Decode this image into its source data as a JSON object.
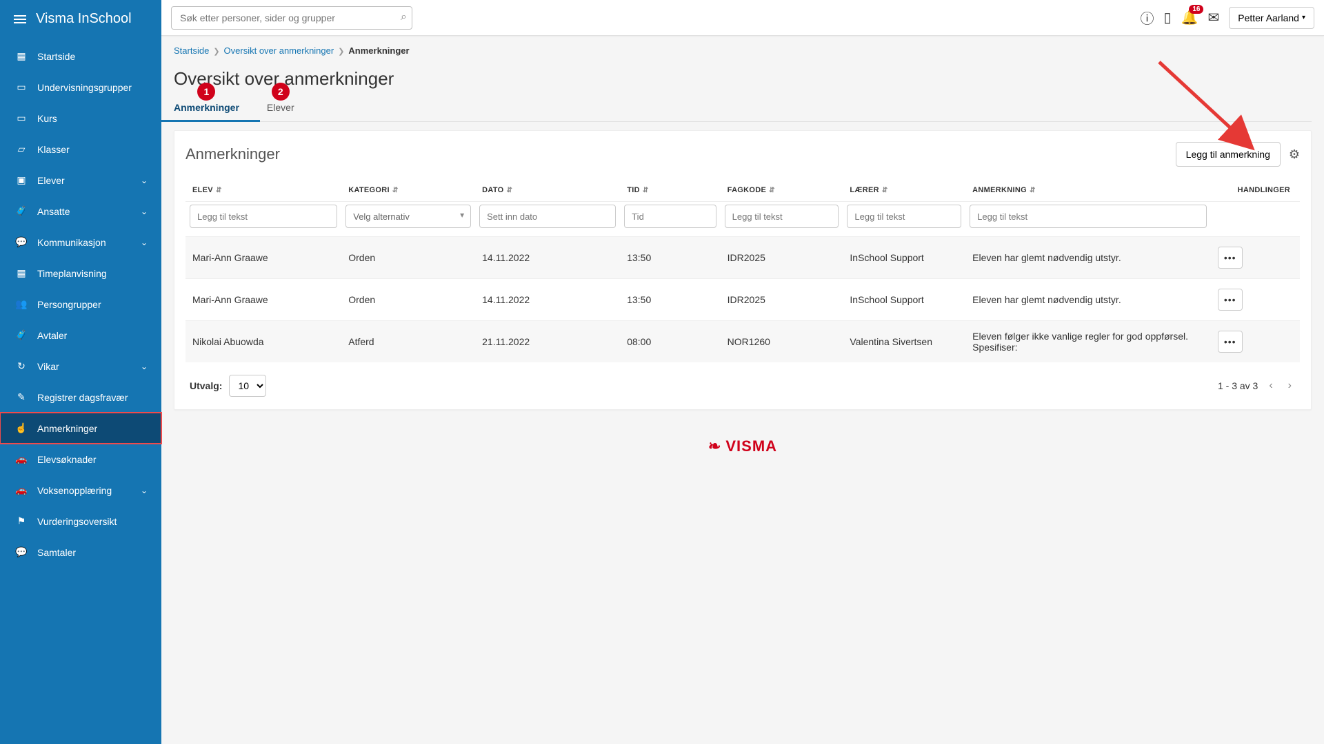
{
  "app_name": "Visma InSchool",
  "search_placeholder": "Søk etter personer, sider og grupper",
  "notifications_count": "16",
  "user_name": "Petter Aarland",
  "sidebar": {
    "items": [
      {
        "label": "Startside",
        "icon": "▦",
        "expandable": false,
        "active": false
      },
      {
        "label": "Undervisningsgrupper",
        "icon": "▭",
        "expandable": false,
        "active": false
      },
      {
        "label": "Kurs",
        "icon": "▭",
        "expandable": false,
        "active": false
      },
      {
        "label": "Klasser",
        "icon": "▱",
        "expandable": false,
        "active": false
      },
      {
        "label": "Elever",
        "icon": "▣",
        "expandable": true,
        "active": false
      },
      {
        "label": "Ansatte",
        "icon": "🧳",
        "expandable": true,
        "active": false
      },
      {
        "label": "Kommunikasjon",
        "icon": "💬",
        "expandable": true,
        "active": false
      },
      {
        "label": "Timeplanvisning",
        "icon": "▦",
        "expandable": false,
        "active": false
      },
      {
        "label": "Persongrupper",
        "icon": "👥",
        "expandable": false,
        "active": false
      },
      {
        "label": "Avtaler",
        "icon": "🧳",
        "expandable": false,
        "active": false
      },
      {
        "label": "Vikar",
        "icon": "↻",
        "expandable": true,
        "active": false
      },
      {
        "label": "Registrer dagsfravær",
        "icon": "✎",
        "expandable": false,
        "active": false
      },
      {
        "label": "Anmerkninger",
        "icon": "☝",
        "expandable": false,
        "active": true
      },
      {
        "label": "Elevsøknader",
        "icon": "🚗",
        "expandable": false,
        "active": false
      },
      {
        "label": "Voksenopplæring",
        "icon": "🚗",
        "expandable": true,
        "active": false
      },
      {
        "label": "Vurderingsoversikt",
        "icon": "⚑",
        "expandable": false,
        "active": false
      },
      {
        "label": "Samtaler",
        "icon": "💬",
        "expandable": false,
        "active": false
      }
    ]
  },
  "breadcrumb": [
    {
      "label": "Startside",
      "link": true
    },
    {
      "label": "Oversikt over anmerkninger",
      "link": true
    },
    {
      "label": "Anmerkninger",
      "link": false
    }
  ],
  "page_title": "Oversikt over anmerkninger",
  "tabs": [
    {
      "label": "Anmerkninger",
      "badge": "1",
      "active": true
    },
    {
      "label": "Elever",
      "badge": "2",
      "active": false
    }
  ],
  "panel": {
    "title": "Anmerkninger",
    "add_button": "Legg til anmerkning",
    "columns": {
      "elev": "ELEV",
      "kategori": "KATEGORI",
      "dato": "DATO",
      "tid": "TID",
      "fagkode": "FAGKODE",
      "laerer": "LÆRER",
      "anmerkning": "ANMERKNING",
      "handlinger": "HANDLINGER"
    },
    "filters": {
      "elev_ph": "Legg til tekst",
      "kategori_ph": "Velg alternativ",
      "dato_ph": "Sett inn dato",
      "tid_ph": "Tid",
      "fagkode_ph": "Legg til tekst",
      "laerer_ph": "Legg til tekst",
      "anmerkning_ph": "Legg til tekst"
    },
    "rows": [
      {
        "elev": "Mari-Ann Graawe",
        "kategori": "Orden",
        "dato": "14.11.2022",
        "tid": "13:50",
        "fagkode": "IDR2025",
        "laerer": "InSchool Support",
        "anmerkning": "Eleven har glemt nødvendig utstyr."
      },
      {
        "elev": "Mari-Ann Graawe",
        "kategori": "Orden",
        "dato": "14.11.2022",
        "tid": "13:50",
        "fagkode": "IDR2025",
        "laerer": "InSchool Support",
        "anmerkning": "Eleven har glemt nødvendig utstyr."
      },
      {
        "elev": "Nikolai Abuowda",
        "kategori": "Atferd",
        "dato": "21.11.2022",
        "tid": "08:00",
        "fagkode": "NOR1260",
        "laerer": "Valentina Sivertsen",
        "anmerkning": "Eleven følger ikke vanlige regler for god oppførsel. Spesifiser:"
      }
    ],
    "footer": {
      "utvalg_label": "Utvalg:",
      "page_size": "10",
      "range": "1 - 3 av 3"
    }
  },
  "footer_brand": "VISMA"
}
